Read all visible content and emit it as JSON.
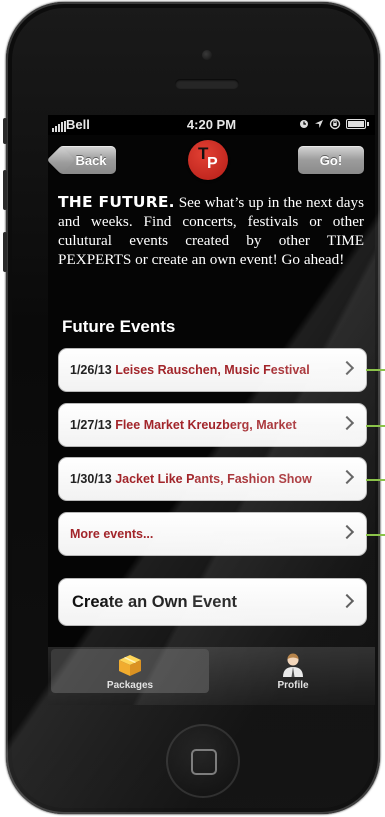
{
  "status_bar": {
    "carrier": "Bell",
    "time": "4:20 PM"
  },
  "nav": {
    "back_label": "Back",
    "go_label": "Go!"
  },
  "intro": {
    "lead": "THE FUTURE.",
    "body": "See what’s up in the next days and weeks. Find concerts, festivals or other culutural events created by other TIME PEXPERTS or create an own event! Go ahead!"
  },
  "section_title": "Future Events",
  "events": [
    {
      "date": "1/26/13",
      "title": "Leises Rauschen, Music Festival"
    },
    {
      "date": "1/27/13",
      "title": "Flee Market Kreuzberg, Market"
    },
    {
      "date": "1/30/13",
      "title": "Jacket Like Pants, Fashion Show"
    }
  ],
  "more_events_label": "More events...",
  "create_event_label": "Create an Own Event",
  "tabs": [
    {
      "label": "Packages",
      "icon": "package-icon",
      "selected": true
    },
    {
      "label": "Profile",
      "icon": "profile-icon",
      "selected": false
    }
  ],
  "colors": {
    "accent_red": "#a2252a",
    "logo_red": "#d3302a",
    "annotation_green": "#8bc34a"
  }
}
